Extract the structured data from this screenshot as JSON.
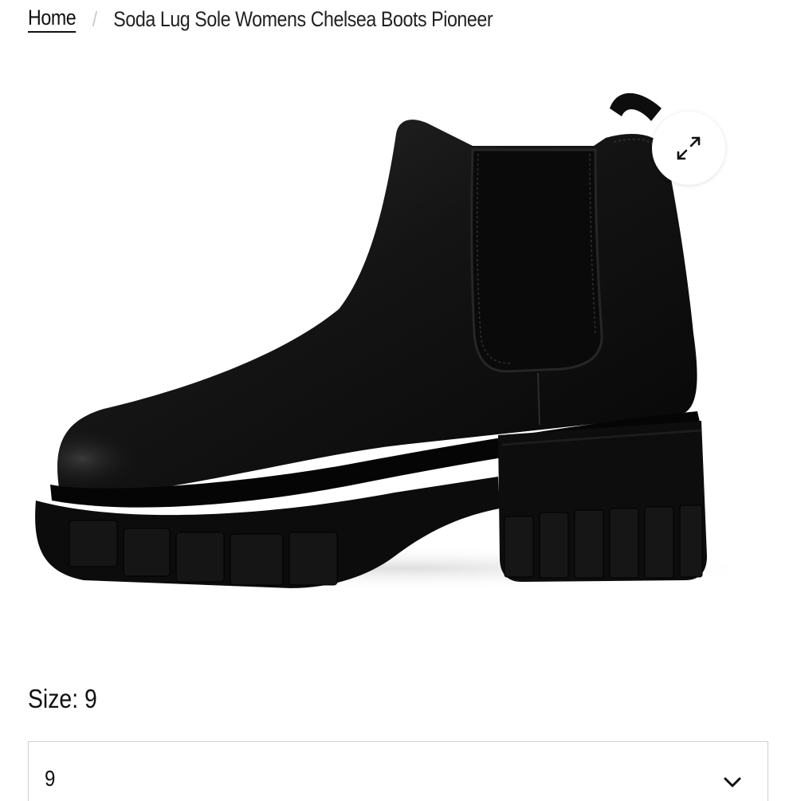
{
  "breadcrumb": {
    "home_label": "Home",
    "separator": "/",
    "current_label": "Soda Lug Sole Womens Chelsea Boots Pioneer"
  },
  "gallery": {
    "image_icon": "black-chelsea-boot-image",
    "zoom_icon": "expand-arrows-icon"
  },
  "variant": {
    "size_prefix": "Size:",
    "size_value": "9",
    "size_label": "Size: 9",
    "selected_option": "9",
    "dropdown_icon": "chevron-down-icon"
  },
  "colors": {
    "text": "#111111",
    "border": "#cfcfcf",
    "separator": "#c8c8c8",
    "background": "#ffffff",
    "product": "#0b0b0b"
  }
}
